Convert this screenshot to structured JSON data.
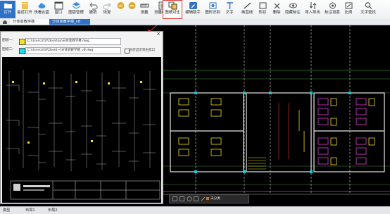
{
  "toolbar": {
    "items": [
      {
        "label": "打开",
        "icon": "folder-open-icon"
      },
      {
        "label": "最近打开",
        "icon": "recent-files-icon"
      },
      {
        "label": "快看云盘",
        "icon": "cloud-drive-icon"
      },
      {
        "label": "窗口",
        "icon": "window-icon"
      },
      {
        "label": "图层管理",
        "icon": "layers-icon"
      },
      {
        "label": "撤销",
        "icon": "undo-icon"
      },
      {
        "label": "恢复",
        "icon": "redo-icon"
      },
      {
        "label": "",
        "icon": "vip-icon"
      },
      {
        "label": "",
        "icon": "tools-icon"
      },
      {
        "label": "测量",
        "icon": "measure-icon"
      },
      {
        "label": "测量统计",
        "icon": "measure-stats-icon"
      },
      {
        "label": "图纸对比",
        "icon": "drawing-compare-icon"
      },
      {
        "label": "编辑助手",
        "icon": "edit-assistant-icon"
      },
      {
        "label": "图形识别",
        "icon": "shape-recognition-icon"
      },
      {
        "label": "文字",
        "icon": "text-icon"
      },
      {
        "label": "画直线",
        "icon": "draw-line-icon"
      },
      {
        "label": "形状",
        "icon": "shape-icon"
      },
      {
        "label": "删除",
        "icon": "delete-icon"
      },
      {
        "label": "隐藏标注",
        "icon": "hide-annotation-icon"
      },
      {
        "label": "导入导出",
        "icon": "import-export-icon"
      },
      {
        "label": "标注设置",
        "icon": "annotation-settings-icon"
      },
      {
        "label": "比例",
        "icon": "scale-icon"
      },
      {
        "label": "文字查找",
        "icon": "text-search-icon"
      }
    ]
  },
  "tabs": [
    {
      "label": "分体变教学楼"
    },
    {
      "label": "分体变教学楼_v8"
    }
  ],
  "compare_panel": {
    "file1_label": "图纸一：",
    "file1_path": "C:\\Users\\zfzf\\Desktop\\分体变教学楼.dwg",
    "file1_color": "#f5e51a",
    "file2_label": "图纸二：",
    "file2_path": "C:\\Users\\zfzf\\Deskt~\\分体变教学楼_v8.dwg",
    "file2_color": "#16e0ef",
    "sync_label": "同步显示到主窗口",
    "close": "×"
  },
  "float_bar": {
    "label": "未分类"
  },
  "bottom_tabs": [
    {
      "label": "模型"
    },
    {
      "label": "布局1"
    },
    {
      "label": "布局2"
    }
  ],
  "colors": {
    "accent": "#2f73c8",
    "highlight": "#e03535"
  }
}
